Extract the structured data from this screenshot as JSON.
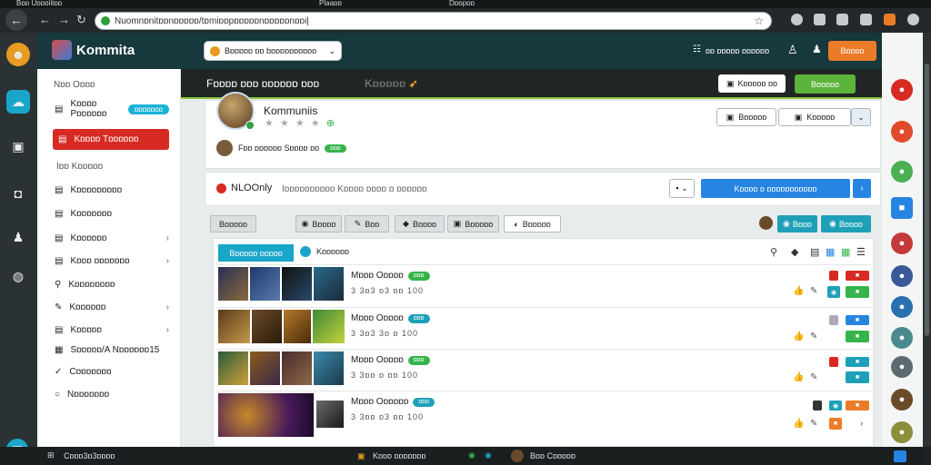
{
  "window": {
    "title_left": "Bɒɒ Uɒɒɒiitɒɒ",
    "title_mid": "Plaaɒɒ",
    "title_mid2": "Dɒɒpɒɒ"
  },
  "browser": {
    "url": "Nuomnɒnitɒɒnɒɒɒɒɒ/tɒmiɒɒpɒɒɒɒɒnɒɒɒɒɒnɒɒi|"
  },
  "app": {
    "name": "Kommita",
    "search_label": "Bɒɒɒɒɒ ɒɒ bɒɒɒɒɒɒɒɒɒɒ",
    "header_link": "ɒɒ ɒɒɒɒɒ ɒɒɒɒɒɒ",
    "header_button": "Bɒɒɒɒ"
  },
  "sidebar": {
    "section1": "Nɒɒ Oɒɒɒ",
    "items_top": [
      {
        "label": "Kɒɒɒɒ Pɒɒɒɒɒɒ",
        "pill": "ɒɒɒɒɒɒɒ"
      },
      {
        "label": "Kɒɒɒɒ Tɒɒɒɒɒɒ",
        "active": true
      }
    ],
    "section2": "Iɒɒ Kɒɒɒɒɒ",
    "items": [
      {
        "label": "Kɒɒɒɒɒɒɒɒɒ"
      },
      {
        "label": "Kɒɒɒɒɒɒɒ"
      },
      {
        "label": "Kɒɒɒɒɒɒ"
      },
      {
        "label": "Kɒɒɒ ɒɒɒɒɒɒɒ"
      },
      {
        "label": "Kɒɒɒɒɒɒɒɒ"
      },
      {
        "label": "Kɒɒɒɒɒɒ"
      },
      {
        "label": "Kɒɒɒɒɒ"
      },
      {
        "label": "Sɒɒɒɒɒ/A Nɒɒɒɒɒɒ15"
      },
      {
        "label": "Cɒɒɒɒɒɒɒ"
      },
      {
        "label": "Nɒɒɒɒɒɒɒ"
      }
    ]
  },
  "banner": {
    "title": "Fɒɒɒɒ ɒɒɒ ɒɒɒɒɒɒ ɒɒɒ",
    "logo": "Kɒɒɒɒɒ",
    "btn1": "Kɒɒɒɒɒ ɒɒ",
    "btn2": "Bɒɒɒɒɒ"
  },
  "profile": {
    "name": "Kommuniis",
    "rating": "★ ★ ★ ★",
    "sub": "Fɒɒ ɒɒɒɒɒɒ Sɒɒɒɒ ɒɒ",
    "sub_pill": "ɒɒɒ",
    "btn1": "Bɒɒɒɒɒ",
    "btn2": "Kɒɒɒɒɒ"
  },
  "content": {
    "title": "NLOOnly",
    "subtitle": "Iɒɒɒɒɒɒɒɒɒɒ Kɒɒɒɒ ɒɒɒɒ ɒ ɒɒɒɒɒɒ",
    "primary_btn": "Kɒɒɒɒ ɒ ɒɒɒɒɒɒɒɒɒɒɒ"
  },
  "filters": [
    "Bɒɒɒɒɒ",
    "Bɒɒɒɒ",
    "Bɒɒ",
    "Bɒɒɒɒ",
    "Bɒɒɒɒɒ",
    "Bɒɒɒɒɒ"
  ],
  "actions": [
    "Bɒɒɒ",
    "Bɒɒɒɒ"
  ],
  "list": {
    "tab_active": "Bɒɒɒɒɒ ɒɒɒɒɒ",
    "tab2": "Kɒɒɒɒɒɒ",
    "rows": [
      {
        "title": "Mɒɒɒ Oɒɒɒɒ",
        "tag": "ɒɒɒ",
        "meta": "3 3ɒ3 ɒ3 ɒɒ 100"
      },
      {
        "title": "Mɒɒɒ Oɒɒɒɒ",
        "tag": "ɒɒɒ",
        "meta": "3 3ɒ3 3ɒ ɒ 100"
      },
      {
        "title": "Mɒɒɒ Oɒɒɒɒ",
        "tag": "ɒɒɒ",
        "meta": "3 3ɒɒ ɒ ɒɒ 100"
      },
      {
        "title": "Mɒɒɒ Oɒɒɒɒɒ",
        "tag": "ɒɒɒ",
        "meta": "3 3ɒɒ ɒ3 ɒɒ 100"
      }
    ]
  },
  "taskbar": {
    "left": "Cɒɒɒ3ɒ3ɒɒɒɒ",
    "mid": "Kɒɒɒ ɒɒɒɒɒɒɒ",
    "right": "Bɒɒ Cɒɒɒɒɒ"
  },
  "colors": {
    "accent_red": "#d72a22",
    "accent_blue": "#2684e3",
    "accent_teal": "#1ea1b8",
    "accent_green": "#5db43a",
    "accent_orange": "#ec7b28"
  }
}
